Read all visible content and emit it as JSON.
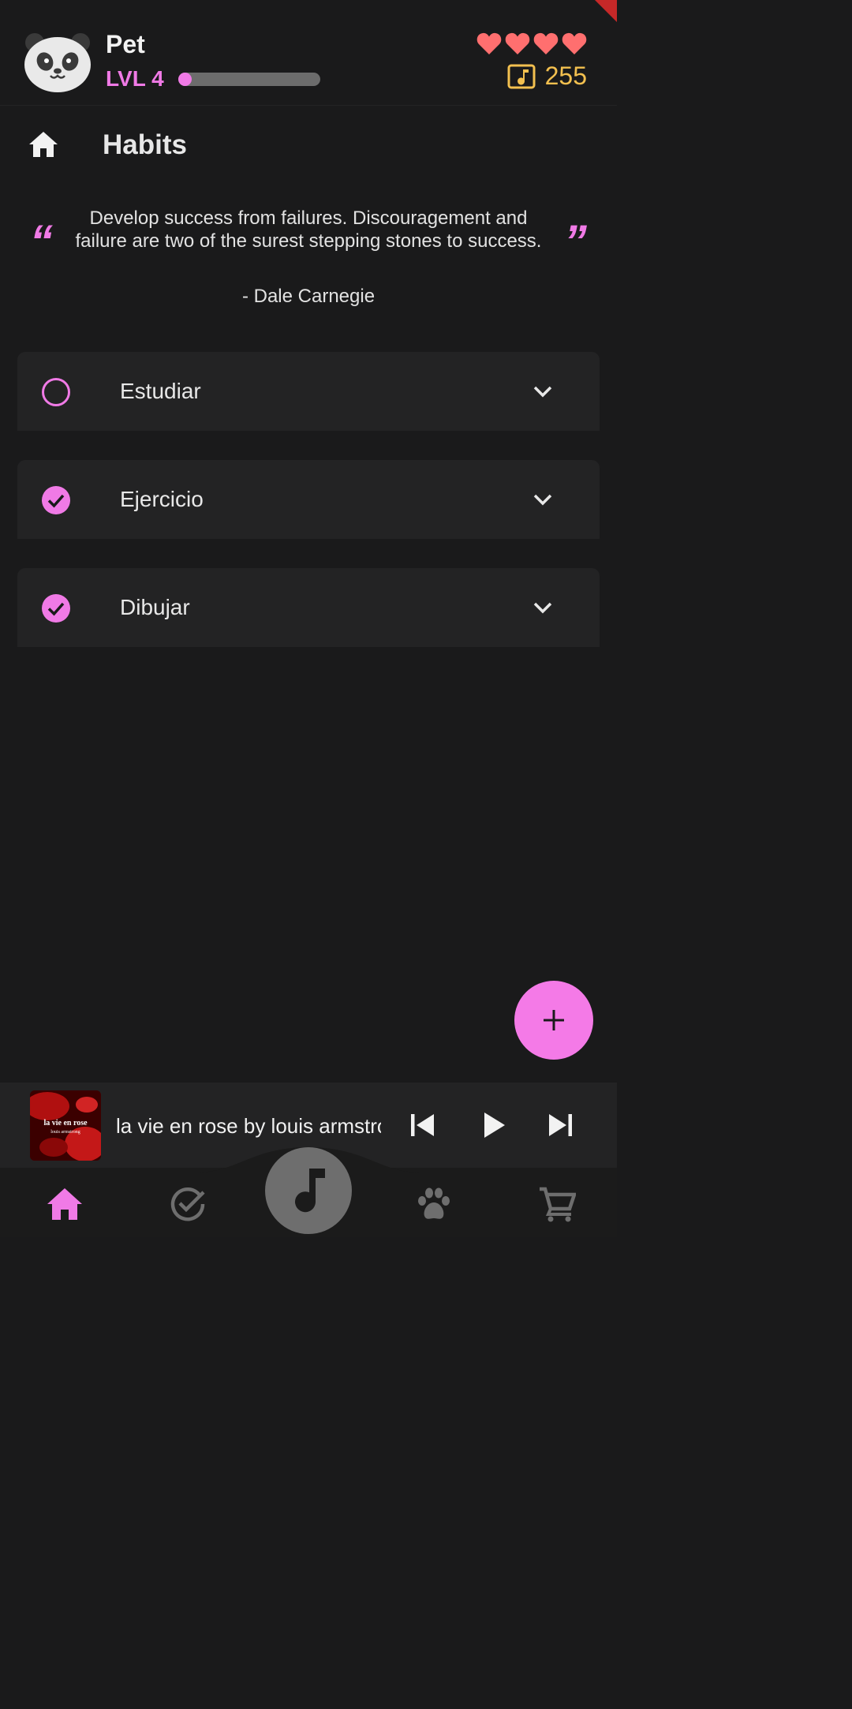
{
  "header": {
    "pet_name": "Pet",
    "level": "LVL 4",
    "xp_progress": 0.08,
    "hearts": 4,
    "coins": "255",
    "colors": {
      "accent": "#f07ae6",
      "hearts": "#ff6f6f",
      "coins": "#f3c04f"
    }
  },
  "page": {
    "title": "Habits",
    "icon": "home-icon"
  },
  "quote": {
    "open_mark": "“",
    "close_mark": "”",
    "text": "Develop success from failures. Discouragement and failure are two of the surest stepping stones to success.",
    "author": "- Dale Carnegie"
  },
  "habits": [
    {
      "name": "Estudiar",
      "done": false
    },
    {
      "name": "Ejercicio",
      "done": true
    },
    {
      "name": "Dibujar",
      "done": true
    }
  ],
  "fab": {
    "icon": "plus-icon"
  },
  "player": {
    "album_art_text_1": "la vie en rose",
    "album_art_text_2": "louis armstrong",
    "song": "la vie en rose by louis armstrong"
  },
  "nav": {
    "items": [
      "home-icon",
      "check-circle-icon",
      "music-note-icon",
      "paw-icon",
      "cart-icon"
    ],
    "active": "home-icon"
  }
}
